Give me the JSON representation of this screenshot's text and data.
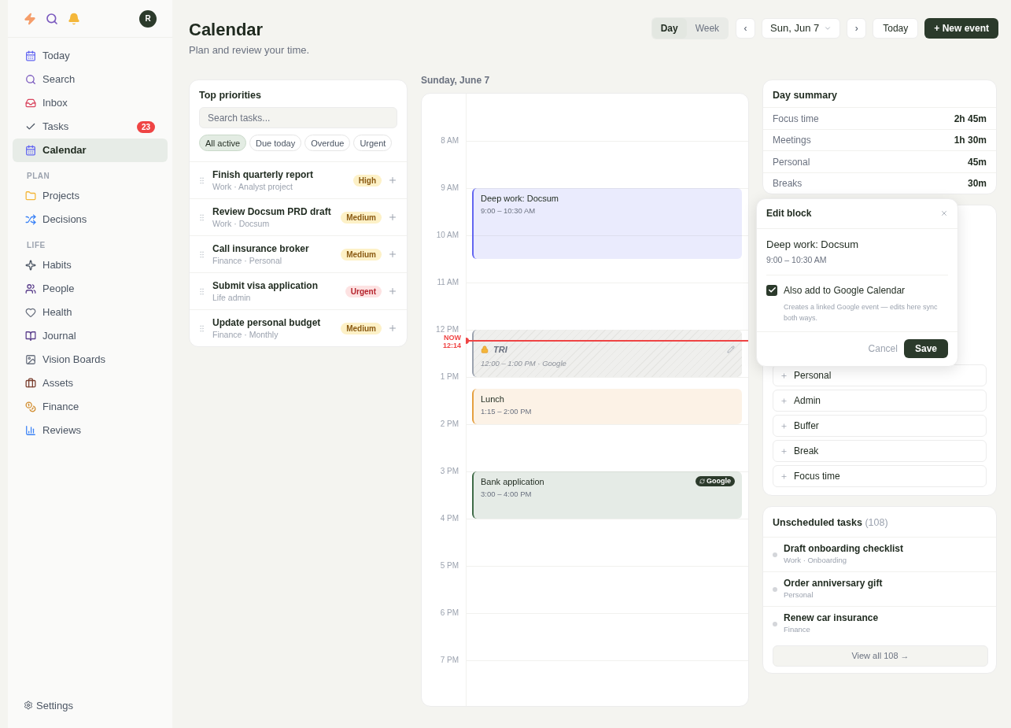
{
  "sidebar": {
    "avatar": "R",
    "nav": [
      {
        "label": "Today",
        "selected": false
      },
      {
        "label": "Search",
        "selected": false
      },
      {
        "label": "Inbox",
        "selected": false
      },
      {
        "label": "Tasks",
        "selected": false,
        "badge": "23"
      },
      {
        "label": "Calendar",
        "selected": true
      }
    ],
    "sections": [
      {
        "heading": "PLAN",
        "items": [
          {
            "label": "Projects",
            "selected": false
          },
          {
            "label": "Decisions",
            "selected": false
          }
        ]
      },
      {
        "heading": "LIFE",
        "items": [
          {
            "label": "Habits",
            "selected": false
          },
          {
            "label": "People",
            "selected": false
          },
          {
            "label": "Health",
            "selected": false
          },
          {
            "label": "Journal",
            "selected": false
          },
          {
            "label": "Vision Boards",
            "selected": false
          },
          {
            "label": "Assets",
            "selected": false
          },
          {
            "label": "Finance",
            "selected": false
          },
          {
            "label": "Reviews",
            "selected": false
          }
        ]
      }
    ],
    "footer": {
      "label": "Settings"
    }
  },
  "header": {
    "title": "Calendar",
    "subtitle": "Plan and review your time.",
    "views": [
      {
        "label": "Day",
        "selected": true
      },
      {
        "label": "Week",
        "selected": false
      }
    ],
    "prev": "‹",
    "date": "Sun, Jun 7",
    "next": "›",
    "today": "Today",
    "new_event": "+ New event"
  },
  "priorities": {
    "title": "Top priorities",
    "search": {
      "placeholder": "Search tasks..."
    },
    "filters": [
      {
        "label": "All active",
        "selected": true
      },
      {
        "label": "Due today",
        "selected": false
      },
      {
        "label": "Overdue",
        "selected": false
      },
      {
        "label": "Urgent",
        "selected": false
      }
    ],
    "tasks": [
      {
        "title": "Finish quarterly report",
        "meta": "Work · Analyst project",
        "priority": "High",
        "kind": "warn"
      },
      {
        "title": "Review Docsum PRD draft",
        "meta": "Work · Docsum",
        "priority": "Medium",
        "kind": "warn"
      },
      {
        "title": "Call insurance broker",
        "meta": "Finance · Personal",
        "priority": "Medium",
        "kind": "warn"
      },
      {
        "title": "Submit visa application",
        "meta": "Life admin",
        "priority": "Urgent",
        "kind": "urgent"
      },
      {
        "title": "Update personal budget",
        "meta": "Finance · Monthly",
        "priority": "Medium",
        "kind": "warn"
      }
    ]
  },
  "calendar": {
    "date": "Sunday, June 7",
    "hours": [
      "8 AM",
      "9 AM",
      "10 AM",
      "11 AM",
      "12 PM",
      "1 PM",
      "2 PM",
      "3 PM",
      "4 PM",
      "5 PM",
      "6 PM",
      "7 PM"
    ],
    "now": {
      "label": "NOW",
      "time": "12:14"
    },
    "events": [
      {
        "title": "Deep work: Docsum",
        "time": "9:00 – 10:30 AM",
        "kind": "block",
        "color": "#6366f1"
      },
      {
        "title": "TRI",
        "time": "12:00 – 1:00 PM · Google",
        "kind": "external",
        "color": "#9ca3af"
      },
      {
        "title": "Lunch",
        "time": "1:15 – 2:00 PM",
        "kind": "block",
        "color": "#e5a040"
      },
      {
        "title": "Bank application",
        "time": "3:00 – 4:00 PM",
        "kind": "block",
        "color": "#3f6b47",
        "badge": "Google"
      }
    ]
  },
  "summary": {
    "title": "Day summary",
    "rows": [
      {
        "label": "Focus time",
        "value": "2h 45m"
      },
      {
        "label": "Meetings",
        "value": "1h 30m"
      },
      {
        "label": "Personal",
        "value": "45m"
      },
      {
        "label": "Breaks",
        "value": "30m"
      }
    ]
  },
  "blocks": [
    "Personal",
    "Admin",
    "Buffer",
    "Break",
    "Focus time"
  ],
  "popover": {
    "title": "Edit block",
    "event_title": "Deep work: Docsum",
    "event_time": "9:00 – 10:30 AM",
    "checkbox": {
      "label": "Also add to Google Calendar",
      "checked": true,
      "hint": "Creates a linked Google event — edits here sync both ways."
    },
    "cancel": "Cancel",
    "save": "Save"
  },
  "unscheduled": {
    "title": "Unscheduled tasks",
    "count": "(108)",
    "tasks": [
      {
        "title": "Draft onboarding checklist",
        "meta": "Work · Onboarding"
      },
      {
        "title": "Order anniversary gift",
        "meta": "Personal"
      },
      {
        "title": "Renew car insurance",
        "meta": "Finance"
      }
    ],
    "view_all": "View all 108 →"
  }
}
